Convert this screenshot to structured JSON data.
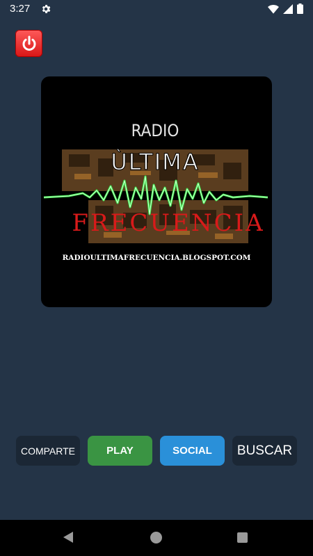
{
  "status_bar": {
    "time": "3:27",
    "icons": [
      "gear-icon",
      "wifi-icon",
      "signal-icon",
      "battery-icon"
    ]
  },
  "power_button": {
    "icon": "power-icon",
    "color": "#e52222"
  },
  "cover": {
    "line1": "RADIO",
    "line2": "ÙLTIMA",
    "line3": "FRECUENCIA",
    "url": "RADIOULTIMAFRECUENCIA.BLOGSPOT.COM",
    "colors": {
      "wave": "#39e64a",
      "title": "#d81a1a",
      "bands": "#6b4a26"
    }
  },
  "buttons": {
    "comparte": "COMPARTE",
    "play": "PLAY",
    "social": "SOCIAL",
    "buscar": "BUSCAR"
  },
  "colors": {
    "background": "#243447",
    "play": "#3a9443",
    "social": "#2a90d9",
    "dark_button": "#1b2735"
  },
  "nav_bar": {
    "icons": [
      "back-icon",
      "home-icon",
      "recents-icon"
    ]
  }
}
